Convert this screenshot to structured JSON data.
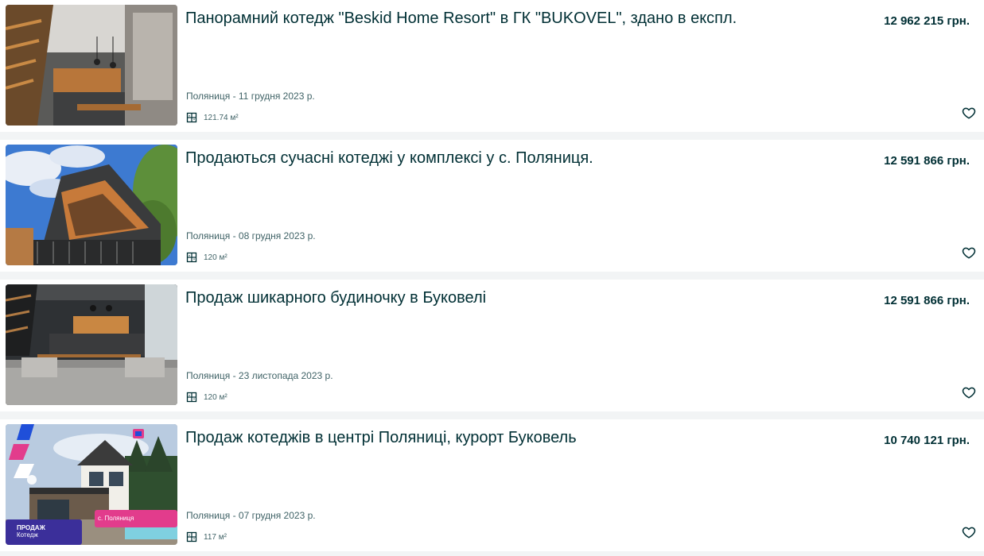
{
  "listings": [
    {
      "title": "Панорамний котедж \"Beskid Home Resort\" в ГК \"BUKOVEL\", здано в експл.",
      "price": "12 962 215 грн.",
      "location_date": "Поляниця - 11 грудня 2023 р.",
      "area": "121.74 м²",
      "photo": "interior-loft-kitchen"
    },
    {
      "title": "Продаються сучасні котеджі у комплексі у с. Поляниця.",
      "price": "12 591 866 грн.",
      "location_date": "Поляниця - 08 грудня 2023 р.",
      "area": "120 м²",
      "photo": "a-frame-cottage-exterior"
    },
    {
      "title": "Продаж шикарного будиночку в Буковелі",
      "price": "12 591 866 грн.",
      "location_date": "Поляниця - 23 листопада 2023 р.",
      "area": "120 м²",
      "photo": "living-room-sofa"
    },
    {
      "title": "Продаж котеджів в центрі Поляниці, курорт Буковель",
      "price": "10 740 121 грн.",
      "location_date": "Поляниця - 07 грудня 2023 р.",
      "area": "117 м²",
      "photo": "cottage-render-promo",
      "photo_badges": {
        "sale": "ПРОДАЖ",
        "sale_sub": "Котедж",
        "place": "с. Поляниця"
      }
    }
  ],
  "icons": {
    "area": "floor-plan-icon",
    "favorite": "heart-outline-icon"
  },
  "colors": {
    "text": "#002f34",
    "muted": "#406367",
    "background": "#f2f4f5",
    "card": "#ffffff"
  }
}
